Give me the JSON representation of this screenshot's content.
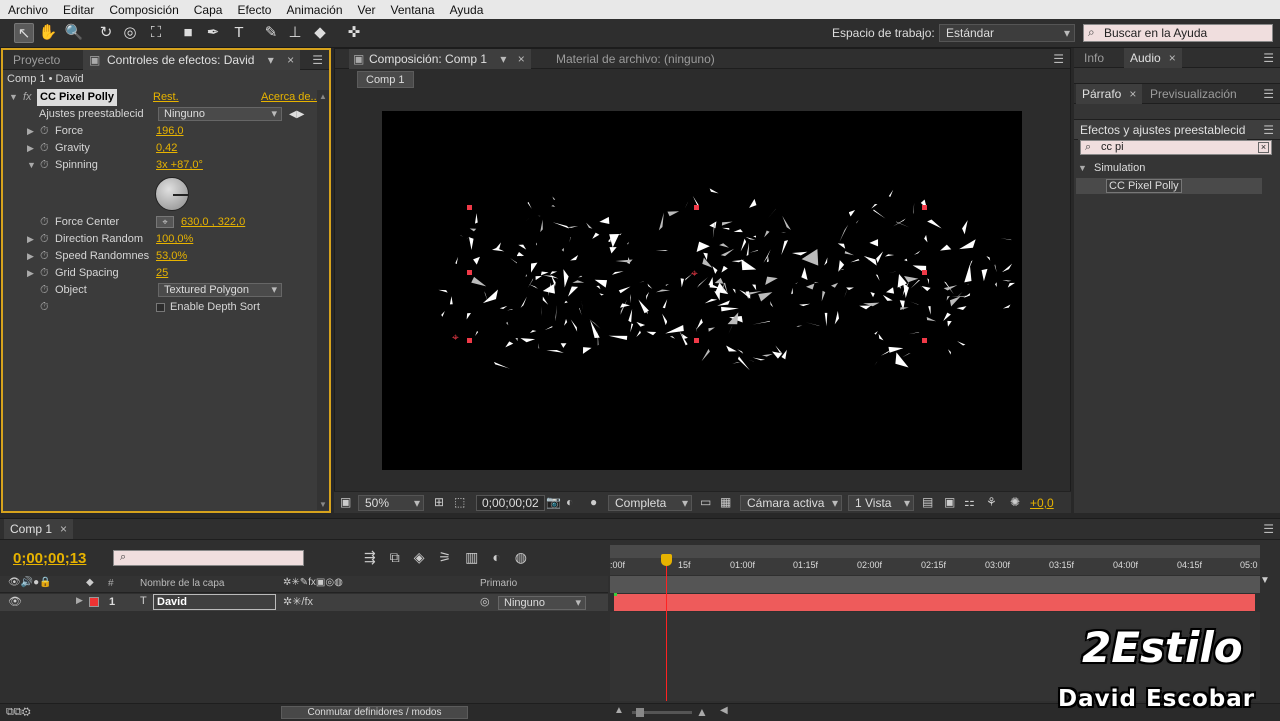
{
  "menubar": [
    "Archivo",
    "Editar",
    "Composición",
    "Capa",
    "Efecto",
    "Animación",
    "Ver",
    "Ventana",
    "Ayuda"
  ],
  "toolbar": {
    "workspace_label": "Espacio de trabajo:",
    "workspace_value": "Estándar",
    "help_search_placeholder": "Buscar en la Ayuda"
  },
  "left_panel": {
    "tabs": [
      "Proyecto",
      "Controles de efectos: David"
    ],
    "breadcrumb": "Comp 1 • David",
    "effect_name": "CC Pixel Polly",
    "reset_label": "Rest.",
    "about_label": "Acerca de...",
    "presets_label": "Ajustes preestablecid",
    "presets_value": "Ninguno",
    "params": [
      {
        "name": "Force",
        "value": "196,0"
      },
      {
        "name": "Gravity",
        "value": "0,42"
      },
      {
        "name": "Spinning",
        "value": "3x +87,0°"
      },
      {
        "name": "Force Center",
        "value": "630,0 , 322,0"
      },
      {
        "name": "Direction Random",
        "value": "100,0%"
      },
      {
        "name": "Speed Randomnes",
        "value": "53,0%"
      },
      {
        "name": "Grid Spacing",
        "value": "25"
      },
      {
        "name": "Object",
        "value": "Textured Polygon"
      }
    ],
    "depth_sort_label": "Enable Depth Sort"
  },
  "comp_panel": {
    "tabs": [
      "Composición: Comp 1",
      "Material de archivo: (ninguno)"
    ],
    "subtab": "Comp 1",
    "zoom": "50%",
    "timecode": "0;00;00;02",
    "resolution": "Completa",
    "camera": "Cámara activa",
    "views": "1 Vista",
    "exposure": "+0,0"
  },
  "right_panel": {
    "tabs_top": [
      "Info",
      "Audio"
    ],
    "tabs_mid": [
      "Párrafo",
      "Previsualización"
    ],
    "effects_title": "Efectos y ajustes preestablecid",
    "search_value": "cc pi",
    "category": "Simulation",
    "result": "CC Pixel Polly"
  },
  "timeline": {
    "tab": "Comp 1",
    "current_time": "0;00;00;13",
    "layer_header": "Nombre de la capa",
    "parent_header": "Primario",
    "layer_number": "1",
    "layer_name": "David",
    "parent_value": "Ninguno",
    "ruler": [
      ":00f",
      "15f",
      "01:00f",
      "01:15f",
      "02:00f",
      "02:15f",
      "03:00f",
      "03:15f",
      "04:00f",
      "04:15f",
      "05:0"
    ],
    "toggle_label": "Conmutar definidores / modos",
    "playhead_fraction": 0.086
  },
  "watermark": {
    "line1": "2Estilo",
    "line2": "David Escobar"
  }
}
